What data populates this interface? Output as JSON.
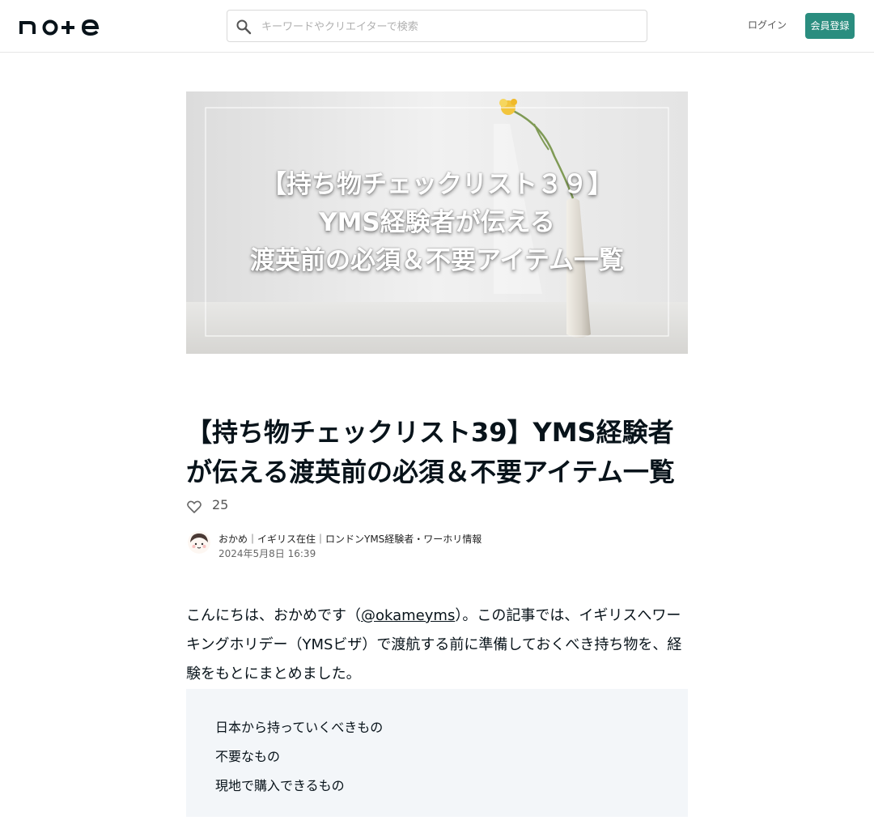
{
  "header": {
    "logo_text": "note",
    "search_placeholder": "キーワードやクリエイターで検索",
    "login_label": "ログイン",
    "signup_label": "会員登録"
  },
  "hero": {
    "lines": [
      "【持ち物チェックリスト３９】",
      "YMS経験者が伝える",
      "渡英前の必須＆不要アイテム一覧"
    ]
  },
  "article": {
    "title": "【持ち物チェックリスト39】YMS経験者が伝える渡英前の必須＆不要アイテム一覧",
    "likes": "25",
    "author_name": "おかめ｜イギリス在住｜ロンドンYMS経験者・ワーホリ情報",
    "date": "2024年5月8日 16:39",
    "intro_prefix": "こんにちは、おかめです（",
    "intro_link": "@okameyms",
    "intro_suffix": "）。この記事では、イギリスへワーキングホリデー（YMSビザ）で渡航する前に準備しておくべき持ち物を、経験をもとにまとめました。",
    "toc": [
      "日本から持っていくべきもの",
      "不要なもの",
      "現地で購入できるもの"
    ]
  },
  "colors": {
    "accent": "#2a8d7f",
    "text": "#08131a",
    "toc_bg": "#f3f6f9"
  }
}
